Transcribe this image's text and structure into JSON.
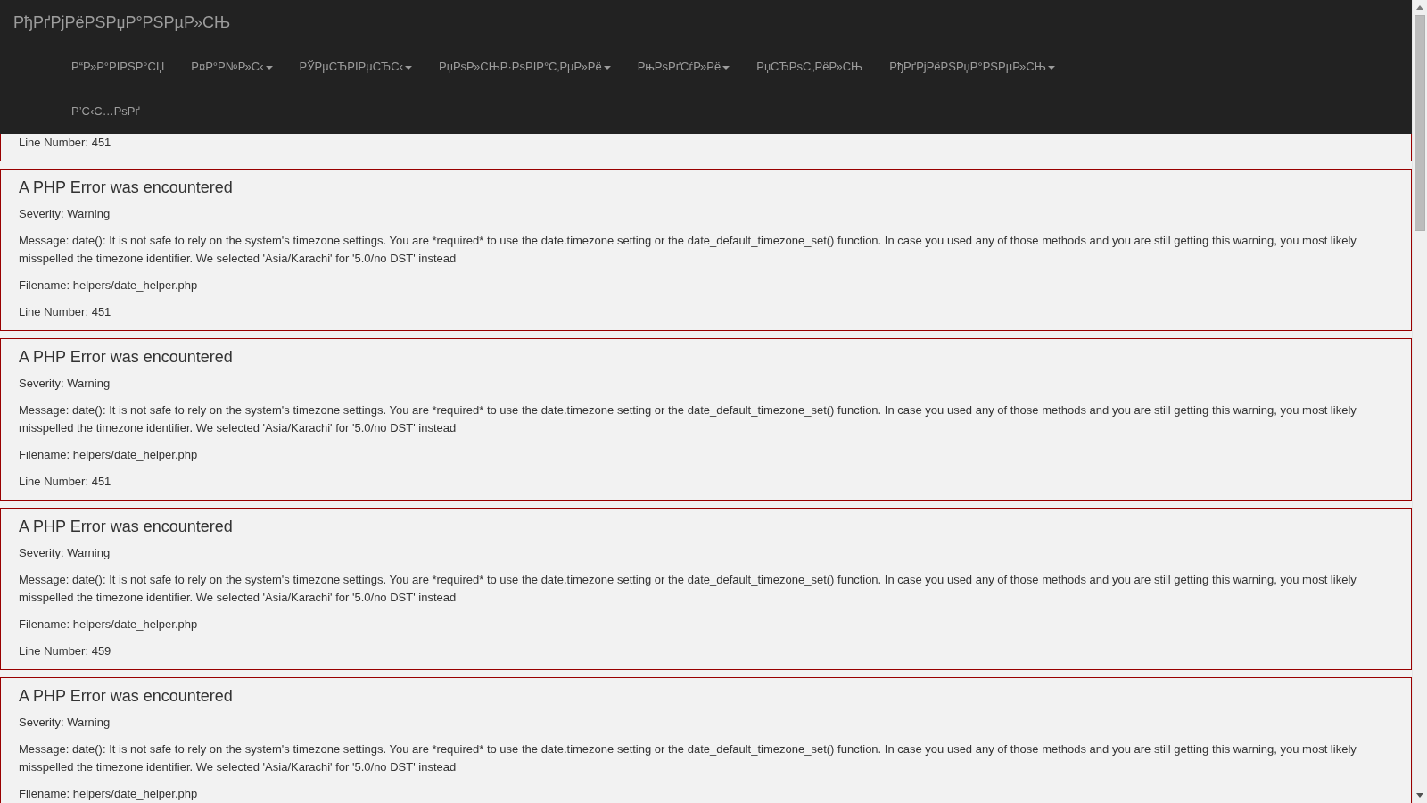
{
  "navbar": {
    "brand": "РђРґРјРёРЅРџР°РЅРµР»СЊ",
    "items": [
      {
        "label": "Р“Р»Р°РІРЅР°СЏ",
        "dropdown": false
      },
      {
        "label": "Р¤Р°Р№Р»С‹",
        "dropdown": true
      },
      {
        "label": "РЎРµСЂРІРµСЂС‹",
        "dropdown": true
      },
      {
        "label": "РџРѕР»СЊР·РѕРІР°С‚РµР»Рё",
        "dropdown": true
      },
      {
        "label": "РњРѕРґСѓР»Рё",
        "dropdown": true
      },
      {
        "label": "РџСЂРѕС„РёР»СЊ",
        "dropdown": false
      },
      {
        "label": "РђРґРјРёРЅРџР°РЅРµР»СЊ",
        "dropdown": true
      },
      {
        "label": "Р’С‹С…РѕРґ",
        "dropdown": false
      }
    ]
  },
  "errors": [
    {
      "line_number": "Line Number: 451"
    },
    {
      "heading": "A PHP Error was encountered",
      "severity": "Severity: Warning",
      "message": "Message: date(): It is not safe to rely on the system's timezone settings. You are *required* to use the date.timezone setting or the date_default_timezone_set() function. In case you used any of those methods and you are still getting this warning, you most likely misspelled the timezone identifier. We selected 'Asia/Karachi' for '5.0/no DST' instead",
      "filename": "Filename: helpers/date_helper.php",
      "line_number": "Line Number: 451"
    },
    {
      "heading": "A PHP Error was encountered",
      "severity": "Severity: Warning",
      "message": "Message: date(): It is not safe to rely on the system's timezone settings. You are *required* to use the date.timezone setting or the date_default_timezone_set() function. In case you used any of those methods and you are still getting this warning, you most likely misspelled the timezone identifier. We selected 'Asia/Karachi' for '5.0/no DST' instead",
      "filename": "Filename: helpers/date_helper.php",
      "line_number": "Line Number: 451"
    },
    {
      "heading": "A PHP Error was encountered",
      "severity": "Severity: Warning",
      "message": "Message: date(): It is not safe to rely on the system's timezone settings. You are *required* to use the date.timezone setting or the date_default_timezone_set() function. In case you used any of those methods and you are still getting this warning, you most likely misspelled the timezone identifier. We selected 'Asia/Karachi' for '5.0/no DST' instead",
      "filename": "Filename: helpers/date_helper.php",
      "line_number": "Line Number: 459"
    },
    {
      "heading": "A PHP Error was encountered",
      "severity": "Severity: Warning",
      "message": "Message: date(): It is not safe to rely on the system's timezone settings. You are *required* to use the date.timezone setting or the date_default_timezone_set() function. In case you used any of those methods and you are still getting this warning, you most likely misspelled the timezone identifier. We selected 'Asia/Karachi' for '5.0/no DST' instead",
      "filename": "Filename: helpers/date_helper.php"
    }
  ]
}
